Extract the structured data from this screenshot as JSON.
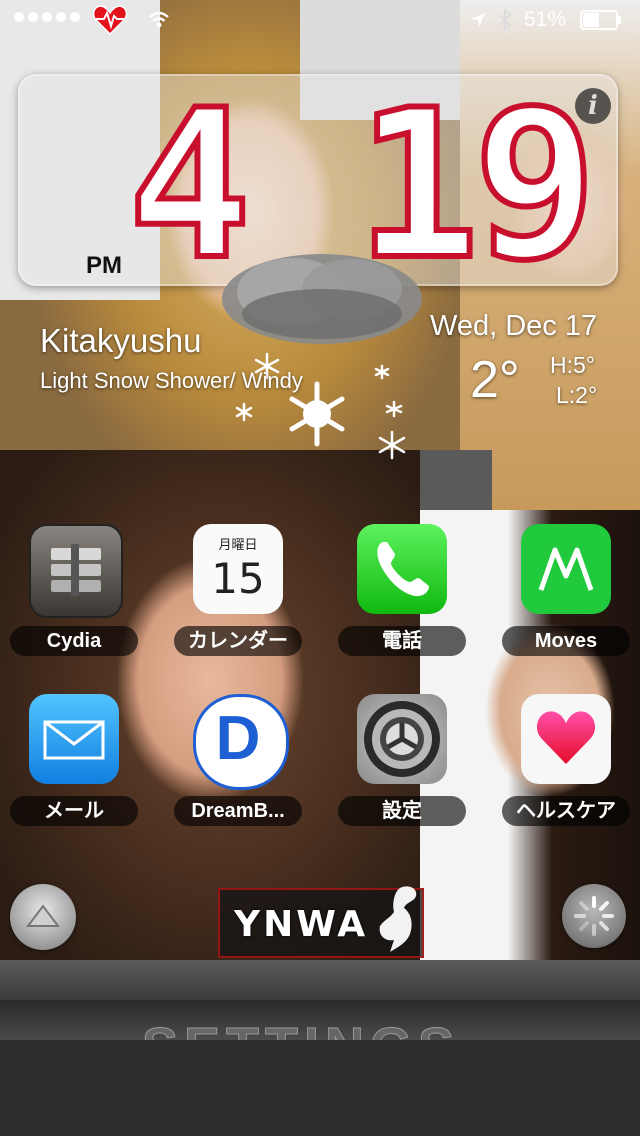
{
  "status_bar": {
    "battery_percent": "51%",
    "signal_dots": 5,
    "heart_icon": "heart-beat-icon",
    "wifi_icon": "wifi-icon",
    "location_icon": "location-arrow-icon",
    "bluetooth_icon": "bluetooth-icon",
    "battery_icon": "battery-icon",
    "battery_level": 0.51
  },
  "clock": {
    "hour": "4",
    "minutes": "19",
    "ampm": "PM",
    "info_label": "i"
  },
  "weather": {
    "city": "Kitakyushu",
    "condition": "Light Snow Shower/ Windy",
    "date": "Wed, Dec 17",
    "temperature": "2°",
    "high": "H:5°",
    "low": "L:2°",
    "icon": "snow-cloud-icon"
  },
  "apps": [
    {
      "label": "Cydia",
      "icon": "cydia-icon"
    },
    {
      "label": "カレンダー",
      "icon": "calendar-icon",
      "weekday": "月曜日",
      "day": "15"
    },
    {
      "label": "電話",
      "icon": "phone-icon"
    },
    {
      "label": "Moves",
      "icon": "moves-icon"
    },
    {
      "label": "メール",
      "icon": "mail-icon"
    },
    {
      "label": "DreamB...",
      "icon": "dreamboard-icon",
      "letter": "D"
    },
    {
      "label": "設定",
      "icon": "settings-gear-icon"
    },
    {
      "label": "ヘルスケア",
      "icon": "health-heart-icon"
    }
  ],
  "controls": {
    "up_button_icon": "triangle-up-icon",
    "spinner_icon": "spinner-icon",
    "ynwa": "YNWA",
    "liverbird_icon": "liverbird-icon"
  },
  "dock": {
    "settings_text": "SETTINGS"
  },
  "colors": {
    "accent_red": "#c8102e",
    "phone_green": "#1fd11f",
    "moves_green": "#21c93d",
    "mail_blue": "#1aa3ef"
  }
}
